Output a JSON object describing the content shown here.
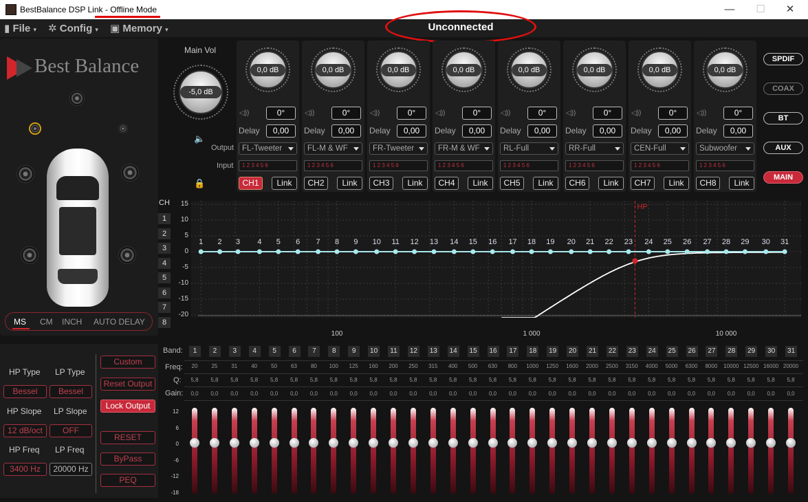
{
  "window": {
    "app": "BestBalance DSP Link",
    "sep": " - ",
    "mode": "Offline Mode",
    "minimize": "—",
    "maximize": "☐",
    "close": "✕"
  },
  "menu": {
    "file": "File",
    "config": "Config",
    "memory": "Memory",
    "caret": "▾"
  },
  "status": {
    "connection": "Unconnected"
  },
  "logo": {
    "text": "Best Balance"
  },
  "units": {
    "ms": "MS",
    "cm": "CM",
    "inch": "INCH",
    "auto_delay": "AUTO DELAY"
  },
  "main_vol": {
    "label": "Main Vol",
    "value": "-5,0 dB"
  },
  "row_labels": {
    "output": "Output",
    "input": "Input",
    "delay": "Delay"
  },
  "channels": [
    {
      "name": "CH1",
      "gain": "0,0 dB",
      "phase": "0°",
      "delay": "0,00",
      "output": "FL-Tweeter",
      "link": "Link",
      "active": true
    },
    {
      "name": "CH2",
      "gain": "0,0 dB",
      "phase": "0°",
      "delay": "0,00",
      "output": "FL-M & WF",
      "link": "Link",
      "active": false
    },
    {
      "name": "CH3",
      "gain": "0,0 dB",
      "phase": "0°",
      "delay": "0,00",
      "output": "FR-Tweeter",
      "link": "Link",
      "active": false
    },
    {
      "name": "CH4",
      "gain": "0,0 dB",
      "phase": "0°",
      "delay": "0,00",
      "output": "FR-M & WF",
      "link": "Link",
      "active": false
    },
    {
      "name": "CH5",
      "gain": "0,0 dB",
      "phase": "0°",
      "delay": "0,00",
      "output": "RL-Full",
      "link": "Link",
      "active": false
    },
    {
      "name": "CH6",
      "gain": "0,0 dB",
      "phase": "0°",
      "delay": "0,00",
      "output": "RR-Full",
      "link": "Link",
      "active": false
    },
    {
      "name": "CH7",
      "gain": "0,0 dB",
      "phase": "0°",
      "delay": "0,00",
      "output": "CEN-Full",
      "link": "Link",
      "active": false
    },
    {
      "name": "CH8",
      "gain": "0,0 dB",
      "phase": "0°",
      "delay": "0,00",
      "output": "Subwoofer",
      "link": "Link",
      "active": false
    }
  ],
  "input_digits": "1 2 3 4 5 6",
  "sources": [
    "SPDIF",
    "COAX",
    "BT",
    "AUX",
    "MAIN"
  ],
  "ch_list": {
    "label": "CH",
    "items": [
      "1",
      "2",
      "3",
      "4",
      "5",
      "6",
      "7",
      "8"
    ]
  },
  "graph": {
    "y_ticks": [
      "15",
      "10",
      "5",
      "0",
      "-5",
      "-10",
      "-15",
      "-20"
    ],
    "x_ticks": [
      "100",
      "1 000",
      "10 000"
    ],
    "hp_marker": "HP",
    "band_labels": [
      "1",
      "2",
      "3",
      "4",
      "5",
      "6",
      "7",
      "8",
      "9",
      "10",
      "11",
      "12",
      "13",
      "14",
      "15",
      "16",
      "17",
      "18",
      "19",
      "20",
      "21",
      "22",
      "23",
      "24",
      "25",
      "26",
      "27",
      "28",
      "29",
      "30",
      "31"
    ],
    "curve_color": "#ffffff",
    "eq_line_color": "#a8e8ec",
    "hp_color": "#d0262c"
  },
  "eq": {
    "band_label": "Band:",
    "freq_label": "Freq:",
    "q_label": "Q:",
    "gain_label": "Gain:",
    "freqs": [
      "20",
      "25",
      "31",
      "40",
      "50",
      "63",
      "80",
      "100",
      "125",
      "160",
      "200",
      "250",
      "315",
      "400",
      "500",
      "630",
      "800",
      "1000",
      "1250",
      "1600",
      "2000",
      "2500",
      "3150",
      "4000",
      "5000",
      "6300",
      "8000",
      "10000",
      "12500",
      "16000",
      "20000"
    ],
    "q": "5,8",
    "gain": "0,0",
    "scale": [
      "12",
      "6",
      "0",
      "-6",
      "-12",
      "-18"
    ]
  },
  "filter": {
    "hp_type_label": "HP Type",
    "lp_type_label": "LP Type",
    "hp_type": "Bessel",
    "lp_type": "Bessel",
    "hp_slope_label": "HP Slope",
    "lp_slope_label": "LP Slope",
    "hp_slope": "12 dB/oct",
    "lp_slope": "OFF",
    "hp_freq_label": "HP Freq",
    "lp_freq_label": "LP Freq",
    "hp_freq": "3400 Hz",
    "lp_freq": "20000 Hz"
  },
  "actions": {
    "custom": "Custom",
    "reset_output": "Reset Output",
    "lock_output": "Lock Output",
    "reset": "RESET",
    "bypass": "ByPass",
    "peq": "PEQ"
  }
}
